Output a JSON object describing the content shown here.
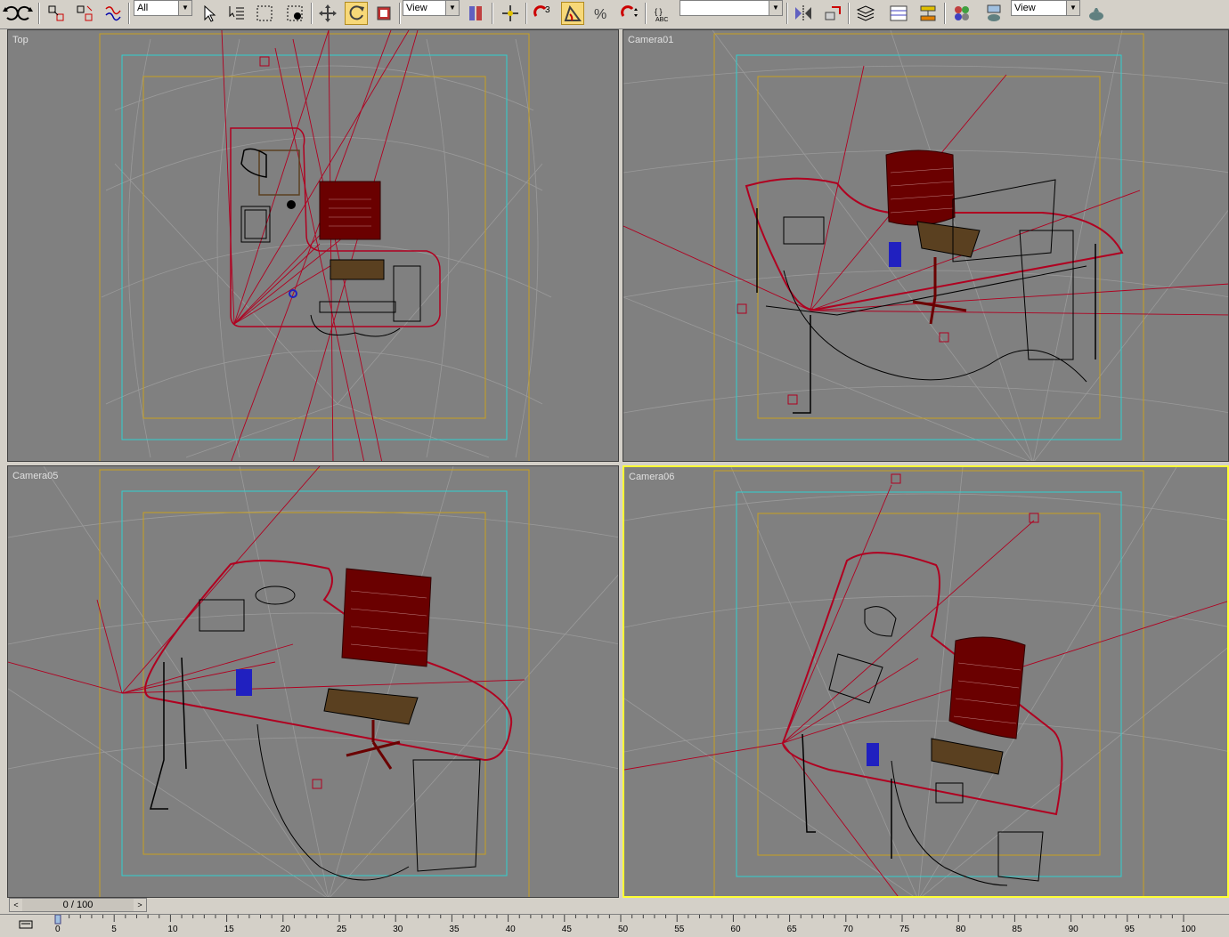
{
  "toolbar": {
    "selection_filter": "All",
    "ref_coord_system": "View",
    "snap_label": "3",
    "named_selection": "",
    "render_view": "View"
  },
  "viewports": [
    {
      "id": "top",
      "label": "Top",
      "active": false
    },
    {
      "id": "camera01",
      "label": "Camera01",
      "active": false
    },
    {
      "id": "camera05",
      "label": "Camera05",
      "active": false
    },
    {
      "id": "camera06",
      "label": "Camera06",
      "active": true
    }
  ],
  "timeline": {
    "frame_display": "0 / 100",
    "prev_label": "<",
    "next_label": ">",
    "ruler_ticks": [
      "0",
      "5",
      "10",
      "15",
      "20",
      "25",
      "30",
      "35",
      "40",
      "45",
      "50",
      "55",
      "60",
      "65",
      "70",
      "75",
      "80",
      "85",
      "90",
      "95",
      "100"
    ]
  },
  "colors": {
    "viewport_bg": "#808080",
    "active_border": "#ffff33",
    "safe_frame_cyan": "#2fd0d0",
    "safe_frame_yellow": "#c8a020",
    "wire_red": "#b00020",
    "chair_red": "#6a0000",
    "pen_blue": "#2020c0"
  },
  "icons": [
    "undo-icon",
    "redo-icon",
    "select-link-icon",
    "unlink-icon",
    "bind-spacewarp-icon",
    "select-object-icon",
    "select-by-name-icon",
    "rect-selection-icon",
    "window-crossing-icon",
    "move-icon",
    "rotate-icon",
    "scale-icon",
    "pivot-icon",
    "manipulate-icon",
    "snap-toggle-icon",
    "angle-snap-icon",
    "percent-snap-icon",
    "spinner-snap-icon",
    "edit-named-selection-icon",
    "mirror-icon",
    "align-icon",
    "layer-manager-icon",
    "curve-editor-icon",
    "schematic-view-icon",
    "material-editor-icon",
    "render-setup-icon",
    "quick-render-icon"
  ]
}
